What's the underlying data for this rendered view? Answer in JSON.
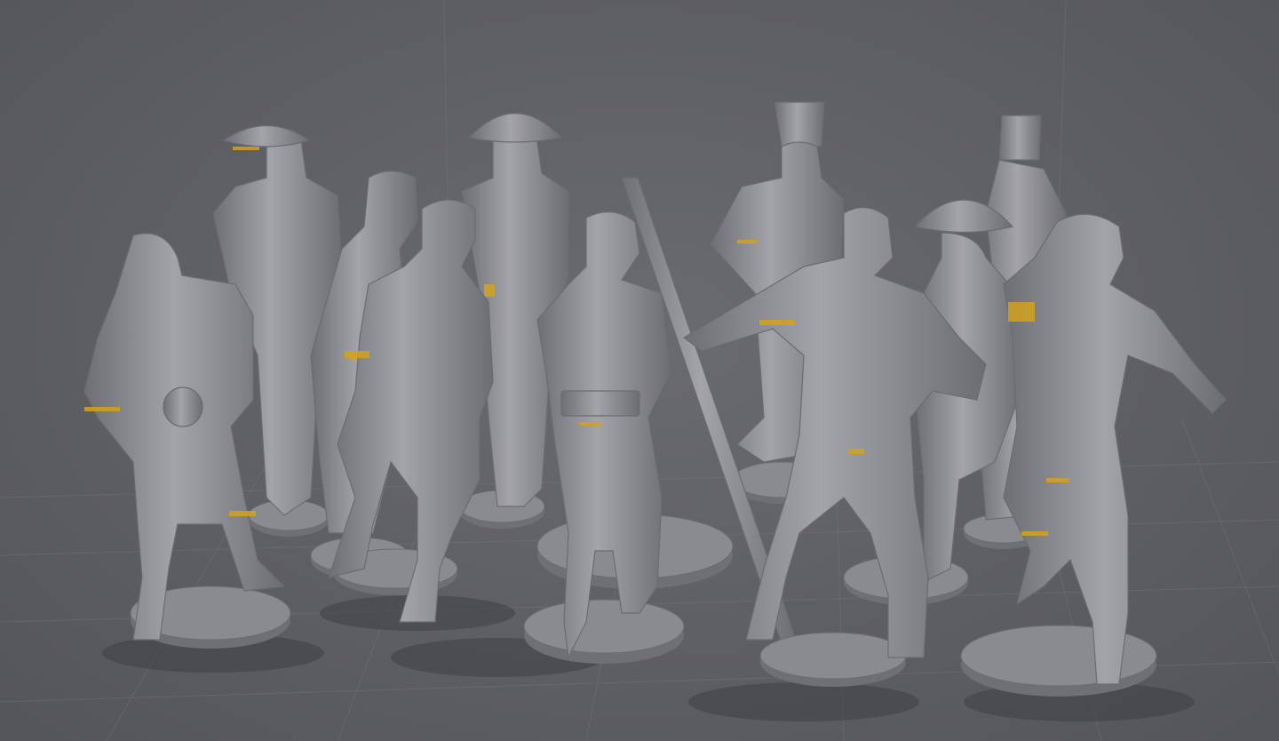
{
  "viewport": {
    "background": "#5f6064",
    "grid_color": "#7a7b80",
    "mesh_color": "#9c9da2",
    "seam_color": "#d2a21d"
  },
  "figures": [
    {
      "name": "figure-kneeling-bowler",
      "headwear": "bandana"
    },
    {
      "name": "figure-officer-epaulettes",
      "headwear": "tricorne-hat"
    },
    {
      "name": "figure-sailor-bandana-rear",
      "headwear": "bandana"
    },
    {
      "name": "figure-bare-chested-sailor",
      "headwear": "knit-cap"
    },
    {
      "name": "figure-captain-tricorne",
      "headwear": "tricorne-hat"
    },
    {
      "name": "figure-sailor-with-box",
      "headwear": "none"
    },
    {
      "name": "figure-marine-shako",
      "headwear": "shako"
    },
    {
      "name": "figure-bald-sailor-pointing",
      "headwear": "none"
    },
    {
      "name": "figure-officer-tricorne-pistol",
      "headwear": "tricorne-hat"
    },
    {
      "name": "figure-marine-shako-rear",
      "headwear": "shako"
    },
    {
      "name": "figure-sailor-drinking",
      "headwear": "knit-cap"
    }
  ]
}
